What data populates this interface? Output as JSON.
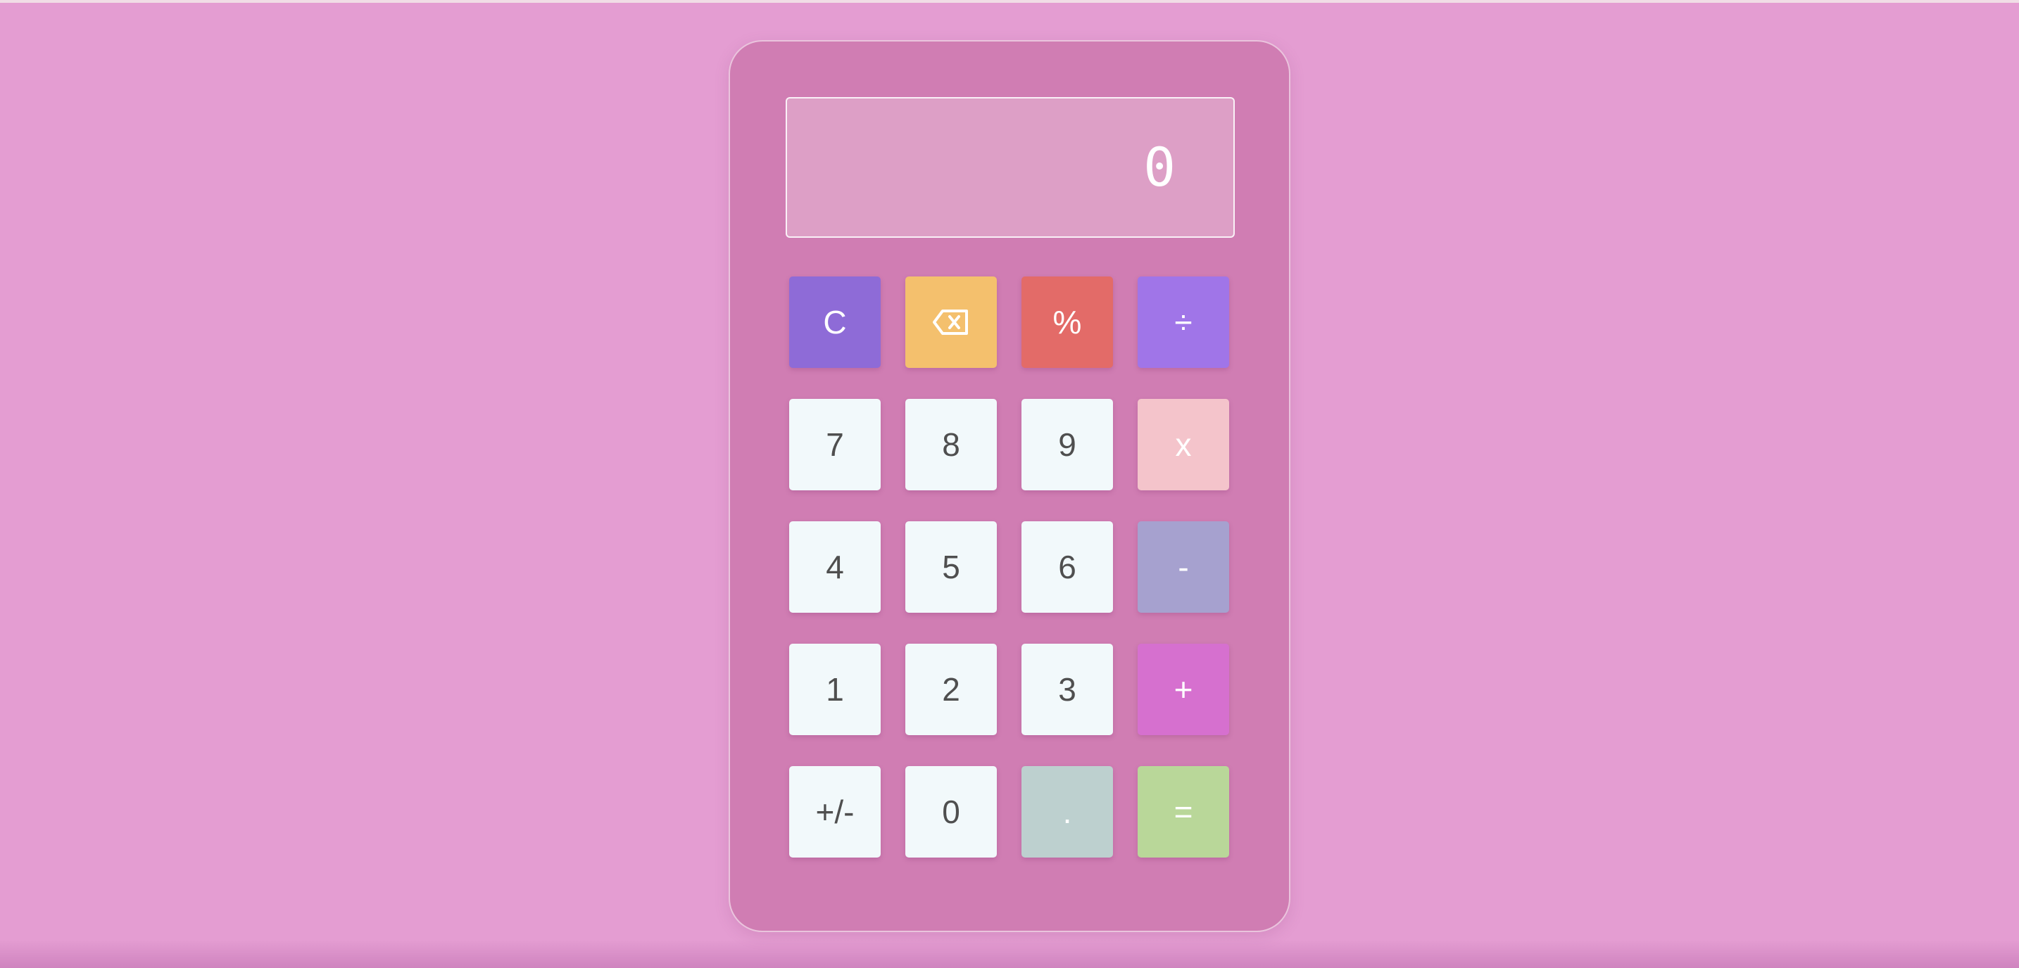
{
  "display": {
    "value": "0"
  },
  "keys": {
    "clear": {
      "label": "C",
      "color": "#8e6bd7"
    },
    "backspace": {
      "icon": "backspace-icon",
      "color": "#f4c06d"
    },
    "percent": {
      "label": "%",
      "color": "#e36b68"
    },
    "divide": {
      "label": "÷",
      "color": "#a075e8"
    },
    "seven": {
      "label": "7"
    },
    "eight": {
      "label": "8"
    },
    "nine": {
      "label": "9"
    },
    "multiply": {
      "label": "x",
      "color": "#f4c4cb"
    },
    "four": {
      "label": "4"
    },
    "five": {
      "label": "5"
    },
    "six": {
      "label": "6"
    },
    "subtract": {
      "label": "-",
      "color": "#a6a1cf"
    },
    "one": {
      "label": "1"
    },
    "two": {
      "label": "2"
    },
    "three": {
      "label": "3"
    },
    "add": {
      "label": "+",
      "color": "#d670cf"
    },
    "negate": {
      "label": "+/-"
    },
    "zero": {
      "label": "0"
    },
    "decimal": {
      "label": ".",
      "color": "#bdd0cf"
    },
    "equals": {
      "label": "=",
      "color": "#b9d799"
    }
  }
}
